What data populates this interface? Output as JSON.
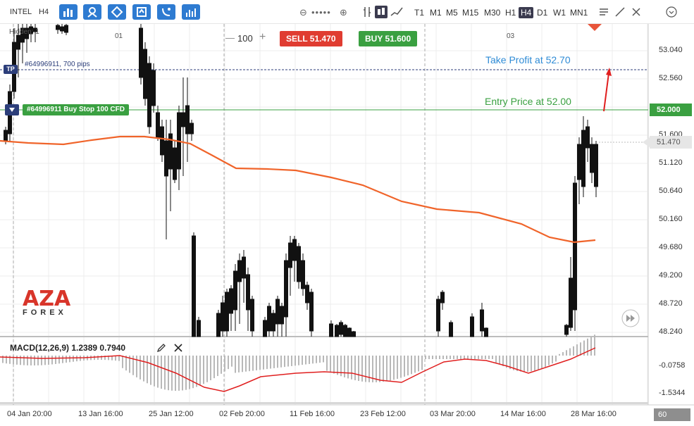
{
  "toolbar": {
    "symbol": "INTEL",
    "timeframe": "H4",
    "tools": [
      {
        "name": "chart-type-icon"
      },
      {
        "name": "indicators-icon"
      },
      {
        "name": "objects-icon"
      },
      {
        "name": "template-icon"
      },
      {
        "name": "alerts-icon"
      },
      {
        "name": "studies-icon"
      }
    ],
    "timeframes": [
      "T1",
      "M1",
      "M5",
      "M15",
      "M30",
      "H1",
      "H4",
      "D1",
      "W1",
      "MN1"
    ],
    "active_timeframe": "H4"
  },
  "trade_panel": {
    "quantity": "100",
    "sell_label": "SELL 51.470",
    "buy_label": "BUY 51.600"
  },
  "annotations": {
    "take_profit": "Take Profit at 52.70",
    "entry_price": "Entry Price at 52.00",
    "tp_badge": "TP",
    "tp_order_text": "#64996911, 700 pips",
    "order_text": "#64996911 Buy Stop 100 CFD",
    "partial_label": "Hidden: 1"
  },
  "price_axis": {
    "labels": [
      "53.040",
      "52.560",
      "51.600",
      "51.120",
      "50.640",
      "50.160",
      "49.680",
      "49.200",
      "48.720",
      "48.240"
    ],
    "entry_tag": "52.000",
    "current_tag": "51.470",
    "macd_labels": [
      "-0.0758",
      "-1.5344"
    ]
  },
  "time_axis": {
    "labels": [
      "04 Jan 20:00",
      "13 Jan 16:00",
      "25 Jan 12:00",
      "02 Feb 20:00",
      "11 Feb 16:00",
      "23 Feb 12:00",
      "03 Mar 20:00",
      "14 Mar 16:00",
      "28 Mar 16:00"
    ],
    "top_marks": [
      "01",
      "03"
    ]
  },
  "indicator": {
    "title": "MACD(12,26,9) 1.2389 0.7940"
  },
  "logo": {
    "text": "AZA",
    "subtext": "FOREX"
  },
  "corner_value": "60",
  "colors": {
    "sell": "#e03c31",
    "buy": "#3aa041",
    "ma_line": "#f0642a",
    "tp_line": "#2c3e7a",
    "entry_line": "#3aa041",
    "take_profit_text": "#2e8bd6",
    "entry_text": "#3aa041",
    "arrow": "#e01e1e"
  }
}
